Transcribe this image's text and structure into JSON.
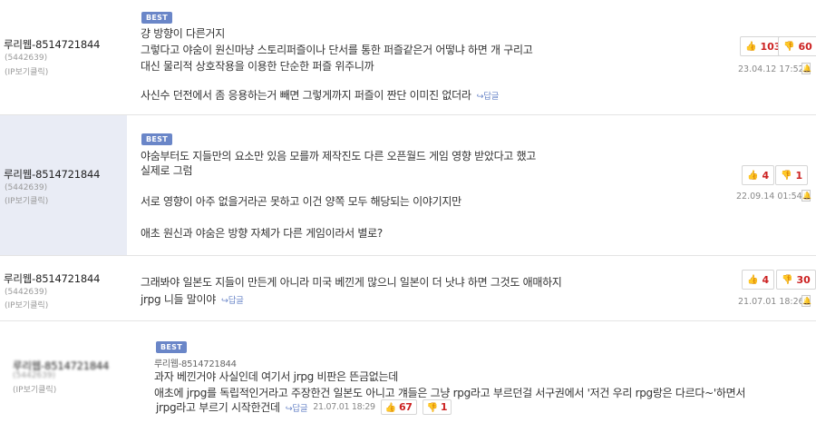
{
  "best_label": "BEST",
  "reply_label": "↪답글",
  "comments": [
    {
      "user": "루리웹-8514721844",
      "user_id": "(5442639)",
      "ip_label": "(IP보기클릭)",
      "lines": [
        "걍 방향이 다른거지",
        "그렇다고 야숨이 원신마냥 스토리퍼즐이나 단서를 통한 퍼즐같은거 어떻냐 하면 개 구리고",
        "대신 물리적 상호작용을 이용한 단순한 퍼즐 위주니까",
        "사신수 던전에서 좀 응용하는거 빼면 그렇게까지 퍼즐이 짠단 이미진 없더라"
      ],
      "up": "103",
      "down": "60",
      "date": "23.04.12 17:52"
    },
    {
      "user": "루리웹-8514721844",
      "user_id": "(5442639)",
      "ip_label": "(IP보기클릭)",
      "lines": [
        "야숨부터도 지들만의 요소만 있음 모를까 제작진도 다른 오픈월드 게임 영향 받았다고 했고",
        "실제로 그럼",
        "서로 영향이 아주 없을거라곤 못하고 이건 양쪽 모두 해당되는 이야기지만",
        "애초 원신과 야숨은 방향 자체가 다른 게임이라서 별로?"
      ],
      "up": "4",
      "down": "1",
      "date": "22.09.14 01:54"
    },
    {
      "user": "루리웹-8514721844",
      "user_id": "(5442639)",
      "ip_label": "(IP보기클릭)",
      "lines": [
        "그래봐야 일본도 지들이 만든게 아니라 미국 베낀게 많으니 일본이 더 낫냐 하면 그것도 애매하지",
        "jrpg 니들 말이야"
      ],
      "up": "4",
      "down": "30",
      "date": "21.07.01 18:26"
    },
    {
      "user": "루리웹-8514721844",
      "user_id": "(5442639)",
      "ip_label": "(IP보기클릭)",
      "quoted_user": "루리웹-8514721844",
      "lines": [
        "과자 베낀거야 사실인데 여기서 jrpg 비판은 뜬금없는데",
        "애초에 jrpg를 독립적인거라고 주장한건 일본도 아니고 걔들은 그냥 rpg라고 부르던걸 서구권에서 '저건 우리 rpg랑은 다르다~'하면서",
        "jrpg라고 부르기 시작한건데"
      ],
      "up": "67",
      "down": "1",
      "date": "21.07.01 18:29"
    }
  ],
  "icons": {
    "up": "thumbs-up-icon",
    "down": "thumbs-down-icon",
    "alarm": "report-bell-icon",
    "reply": "reply-arrow-icon"
  },
  "colors": {
    "best_badge": "#6a86c8",
    "vote_count": "#cc2222",
    "highlight_bg": "#e9ecf5"
  }
}
